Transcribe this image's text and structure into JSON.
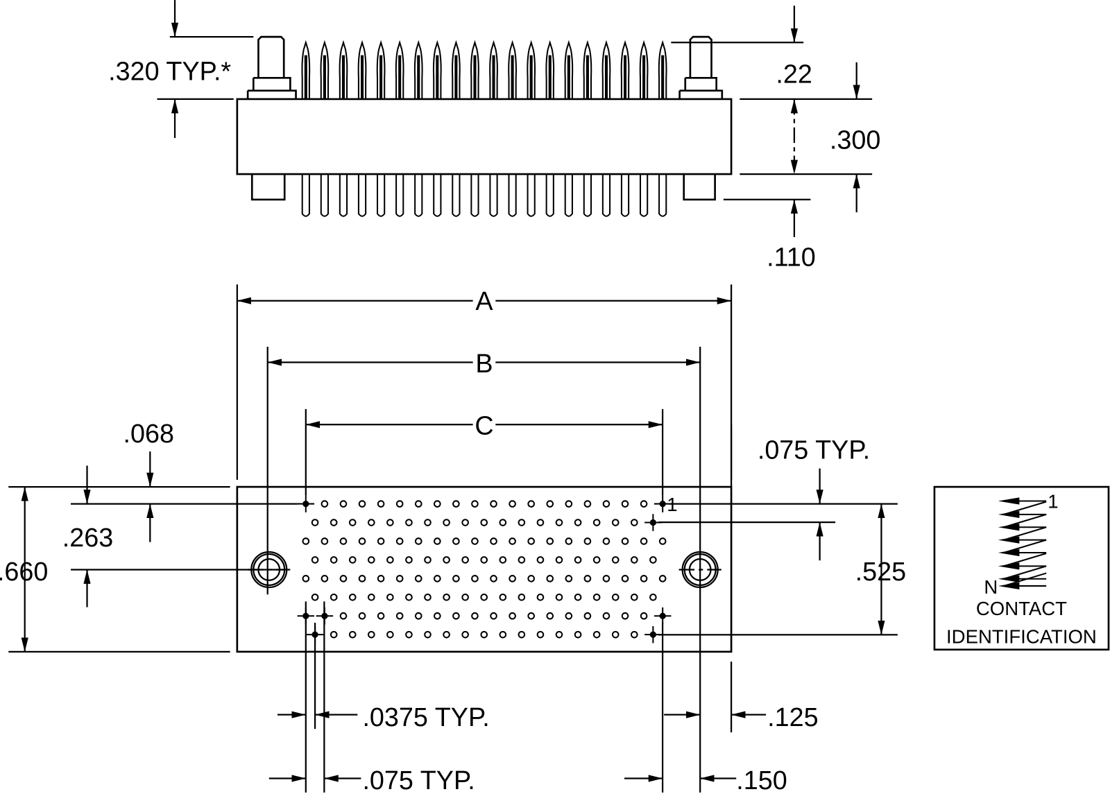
{
  "top_view": {
    "dim_320": ".320 TYP.*",
    "dim_22": ".22",
    "dim_300": ".300",
    "dim_110": ".110",
    "pin_count": 20
  },
  "bottom_view": {
    "dim_A": "A",
    "dim_B": "B",
    "dim_C": "C",
    "dim_068": ".068",
    "dim_263": ".263",
    "dim_660": ".660",
    "dim_075_typ_right": ".075 TYP.",
    "dim_525": ".525",
    "dim_0375_typ": ".0375 TYP.",
    "dim_075_typ_bottom": ".075 TYP.",
    "dim_125": ".125",
    "dim_150": ".150",
    "pin_1_label": "1",
    "rows": 8,
    "holes_per_long_row": 20,
    "holes_per_short_row": 19
  },
  "contact_identification": {
    "first_label": "1",
    "last_label": "N",
    "title_line1": "CONTACT",
    "title_line2": "IDENTIFICATION"
  }
}
